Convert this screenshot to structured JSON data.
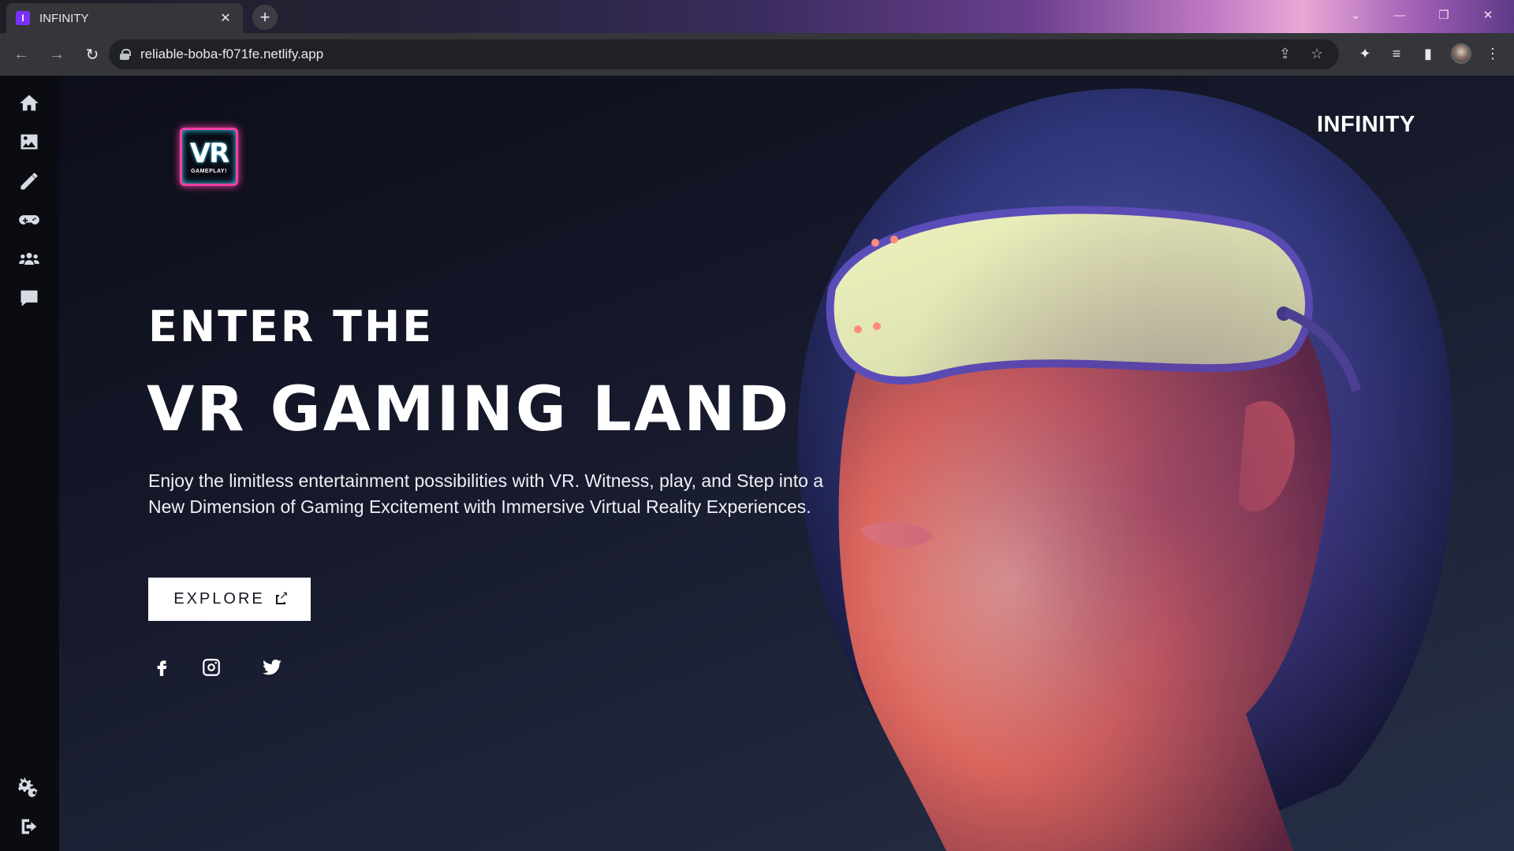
{
  "browser": {
    "tab_title": "INFINITY",
    "tab_favicon_letter": "I",
    "close_glyph": "✕",
    "newtab_glyph": "+",
    "url": "reliable-boba-f071fe.netlify.app",
    "back_glyph": "←",
    "forward_glyph": "→",
    "reload_glyph": "↻",
    "window_controls": {
      "dropdown": "⌄",
      "minimize": "—",
      "restore": "❐",
      "close": "✕"
    },
    "toolbar_icons": {
      "share": "⇪",
      "bookmark": "☆",
      "extensions": "✦",
      "media": "≡",
      "sidepanel": "▮",
      "menu": "⋮"
    }
  },
  "sidebar": {
    "items": [
      {
        "icon": "home-icon"
      },
      {
        "icon": "image-icon"
      },
      {
        "icon": "pencil-icon"
      },
      {
        "icon": "gamepad-icon"
      },
      {
        "icon": "users-icon"
      },
      {
        "icon": "chat-icon"
      }
    ],
    "bottom": [
      {
        "icon": "gears-icon"
      },
      {
        "icon": "logout-icon"
      }
    ]
  },
  "hero": {
    "logo_main": "VR",
    "logo_sub": "GAMEPLAY!",
    "brand": "INFINITY",
    "heading_small": "ENTER THE",
    "heading_big": "VR GAMING LAND",
    "description": "Enjoy the limitless entertainment possibilities with VR. Witness, play, and Step into a New Dimension of Gaming Excitement with Immersive Virtual Reality Experiences.",
    "cta_label": "EXPLORE",
    "social": [
      "facebook-icon",
      "instagram-icon",
      "twitter-icon"
    ]
  },
  "colors": {
    "accent_pink": "#ff3fa4",
    "accent_cyan": "#2bd9ff",
    "visor": "#e8edb0"
  }
}
